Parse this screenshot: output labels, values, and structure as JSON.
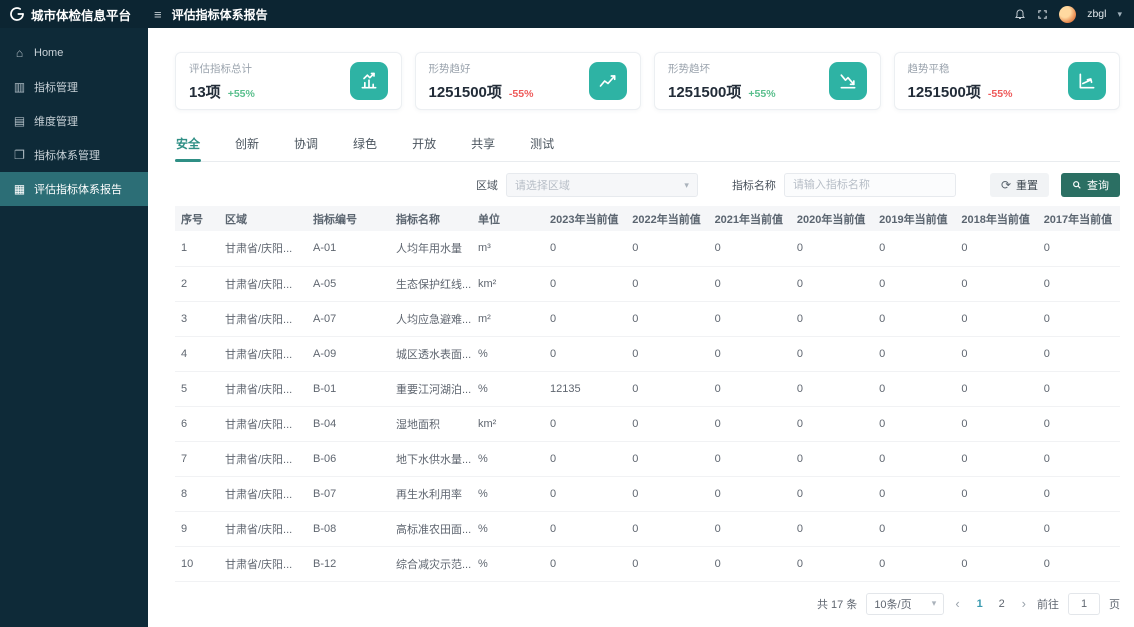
{
  "app": {
    "title": "城市体检信息平台",
    "page_title": "评估指标体系报告",
    "user": "zbgl"
  },
  "sidebar": {
    "items": [
      {
        "id": "home",
        "label": "Home",
        "icon": "home-icon",
        "active": false
      },
      {
        "id": "indicator-management",
        "label": "指标管理",
        "icon": "chart-icon",
        "active": false
      },
      {
        "id": "dimension-management",
        "label": "维度管理",
        "icon": "card-icon",
        "active": false
      },
      {
        "id": "indicator-system-management",
        "label": "指标体系管理",
        "icon": "folder-icon",
        "active": false
      },
      {
        "id": "evaluation-report",
        "label": "评估指标体系报告",
        "icon": "grid-icon",
        "active": true
      }
    ]
  },
  "cards": [
    {
      "title": "评估指标总计",
      "value": "13项",
      "delta": "+55%",
      "trend": "up",
      "icon": "bar-chart-icon"
    },
    {
      "title": "形势趋好",
      "value": "1251500项",
      "delta": "-55%",
      "trend": "down",
      "icon": "line-chart-up-icon"
    },
    {
      "title": "形势趋坏",
      "value": "1251500项",
      "delta": "+55%",
      "trend": "up",
      "icon": "line-chart-down-icon"
    },
    {
      "title": "趋势平稳",
      "value": "1251500项",
      "delta": "-55%",
      "trend": "down",
      "icon": "line-chart-flat-icon"
    }
  ],
  "tabs": [
    {
      "label": "安全",
      "active": true
    },
    {
      "label": "创新",
      "active": false
    },
    {
      "label": "协调",
      "active": false
    },
    {
      "label": "绿色",
      "active": false
    },
    {
      "label": "开放",
      "active": false
    },
    {
      "label": "共享",
      "active": false
    },
    {
      "label": "测试",
      "active": false
    }
  ],
  "filters": {
    "region_label": "区域",
    "region_placeholder": "请选择区域",
    "indicator_label": "指标名称",
    "indicator_placeholder": "请输入指标名称",
    "reset_label": "重置",
    "search_label": "查询"
  },
  "table": {
    "headers": [
      "序号",
      "区域",
      "指标编号",
      "指标名称",
      "单位",
      "2023年当前值",
      "2022年当前值",
      "2021年当前值",
      "2020年当前值",
      "2019年当前值",
      "2018年当前值",
      "2017年当前值"
    ],
    "rows": [
      [
        "1",
        "甘肃省/庆阳...",
        "A-01",
        "人均年用水量",
        "m³",
        "0",
        "0",
        "0",
        "0",
        "0",
        "0",
        "0"
      ],
      [
        "2",
        "甘肃省/庆阳...",
        "A-05",
        "生态保护红线...",
        "km²",
        "0",
        "0",
        "0",
        "0",
        "0",
        "0",
        "0"
      ],
      [
        "3",
        "甘肃省/庆阳...",
        "A-07",
        "人均应急避难...",
        "m²",
        "0",
        "0",
        "0",
        "0",
        "0",
        "0",
        "0"
      ],
      [
        "4",
        "甘肃省/庆阳...",
        "A-09",
        "城区透水表面...",
        "%",
        "0",
        "0",
        "0",
        "0",
        "0",
        "0",
        "0"
      ],
      [
        "5",
        "甘肃省/庆阳...",
        "B-01",
        "重要江河湖泊...",
        "%",
        "12135",
        "0",
        "0",
        "0",
        "0",
        "0",
        "0"
      ],
      [
        "6",
        "甘肃省/庆阳...",
        "B-04",
        "湿地面积",
        "km²",
        "0",
        "0",
        "0",
        "0",
        "0",
        "0",
        "0"
      ],
      [
        "7",
        "甘肃省/庆阳...",
        "B-06",
        "地下水供水量...",
        "%",
        "0",
        "0",
        "0",
        "0",
        "0",
        "0",
        "0"
      ],
      [
        "8",
        "甘肃省/庆阳...",
        "B-07",
        "再生水利用率",
        "%",
        "0",
        "0",
        "0",
        "0",
        "0",
        "0",
        "0"
      ],
      [
        "9",
        "甘肃省/庆阳...",
        "B-08",
        "高标准农田面...",
        "%",
        "0",
        "0",
        "0",
        "0",
        "0",
        "0",
        "0"
      ],
      [
        "10",
        "甘肃省/庆阳...",
        "B-12",
        "综合减灾示范...",
        "%",
        "0",
        "0",
        "0",
        "0",
        "0",
        "0",
        "0"
      ]
    ]
  },
  "pagination": {
    "total_label": "共 17 条",
    "page_size": "10条/页",
    "pages": [
      "1",
      "2"
    ],
    "active_page": "1",
    "goto_label": "前往",
    "goto_value": "1",
    "page_suffix": "页"
  },
  "colors": {
    "accent_teal": "#2eb3a4",
    "dark_bg": "#0c2532",
    "sidebar_bg": "#0e2a38",
    "active_menu": "#2c6e76",
    "success_green": "#5abf8d",
    "danger_red": "#ee5a5a",
    "primary_button": "#2b6f63",
    "active_tab": "#2f8f85",
    "active_page": "#3a9ab0"
  }
}
